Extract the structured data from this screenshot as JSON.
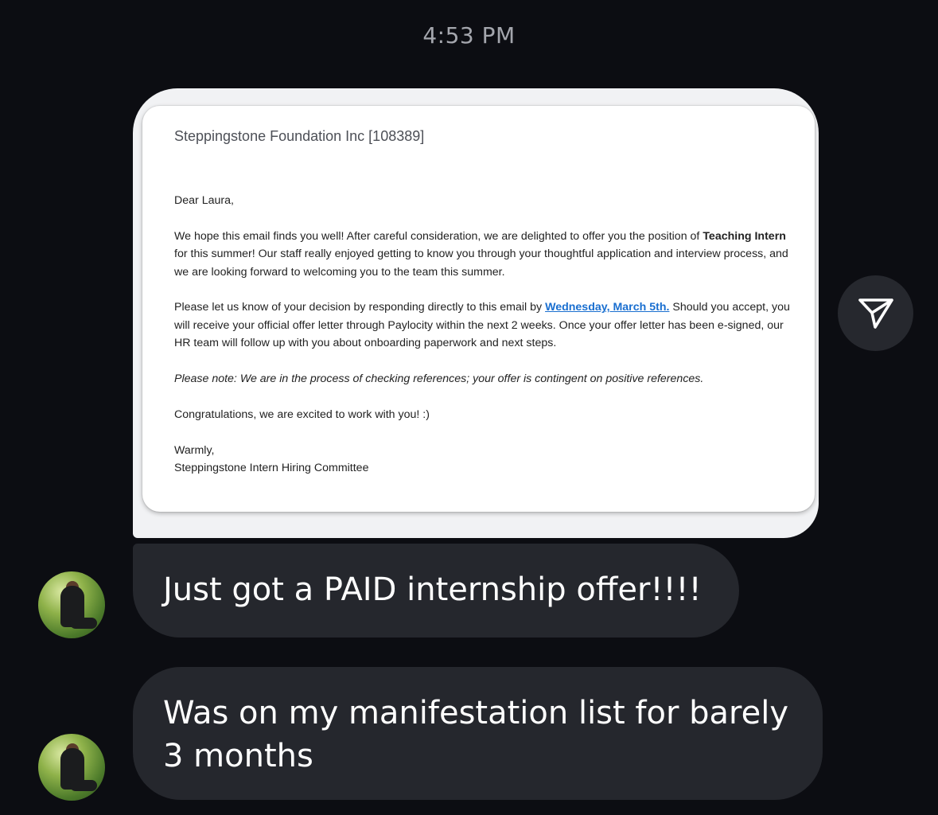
{
  "timestamp": "4:53 PM",
  "shared_image": {
    "sender": "Steppingstone Foundation Inc [108389]",
    "greeting": "Dear Laura,",
    "p1": {
      "before": "We hope this email finds you well! After careful consideration, we are delighted to offer you the position of ",
      "role": "Teaching Intern",
      "after": " for this summer! Our staff really enjoyed getting to know you through your thoughtful application and interview process, and we are looking forward to welcoming you to the team this summer."
    },
    "p2": {
      "before": "Please let us know of your decision by responding directly to this email by ",
      "deadline": "Wednesday, March 5th.",
      "after": " Should you accept, you will receive your official offer letter through Paylocity within the next 2 weeks. Once your offer letter has been e-signed, our HR team will follow up with you about onboarding paperwork and next steps."
    },
    "note": "Please note: We are in the process of checking references; your offer is contingent on positive references.",
    "congrats": "Congratulations, we are excited to work with you! :)",
    "closing": "Warmly,",
    "signature": "Steppingstone Intern Hiring Committee"
  },
  "share_icon": "paper-plane-icon",
  "messages": [
    {
      "text": "Just got a PAID internship offer!!!!"
    },
    {
      "text": "Was on my manifestation list for barely 3 months"
    }
  ],
  "colors": {
    "background": "#0c0d12",
    "bubble": "#25272d",
    "link": "#1a6fd0"
  }
}
